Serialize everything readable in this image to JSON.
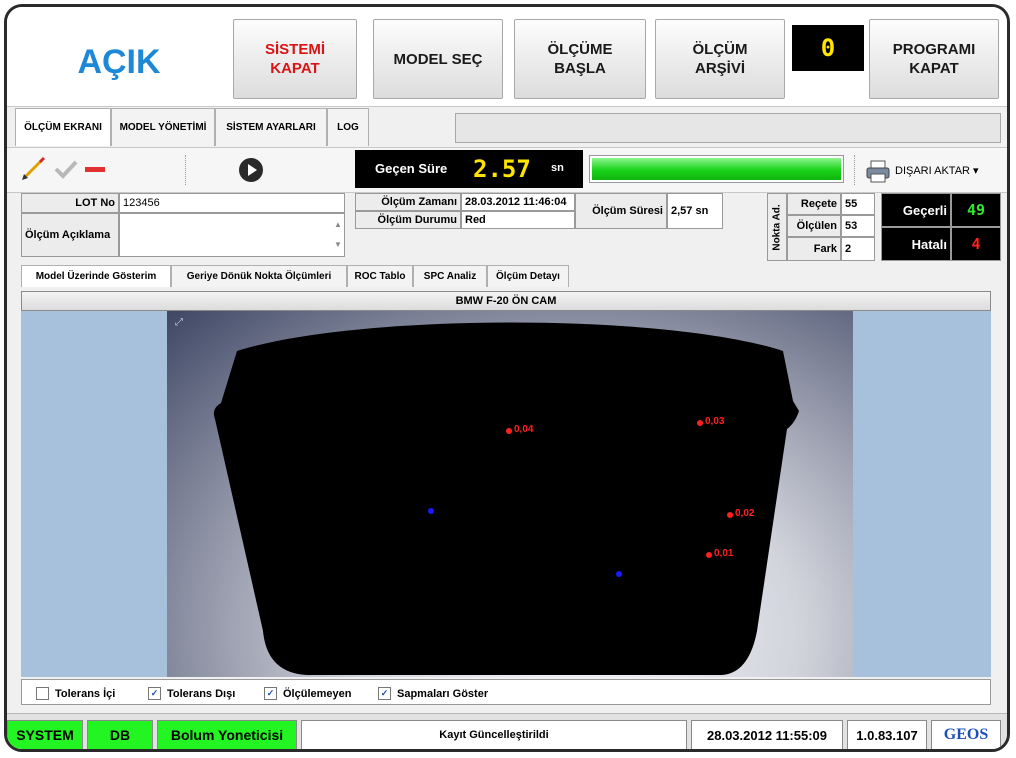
{
  "header": {
    "state": "AÇIK",
    "buttons": {
      "shutdown_system": "SİSTEMİ\nKAPAT",
      "select_model": "MODEL SEÇ",
      "start_measure": "ÖLÇÜME\nBAŞLA",
      "archive": "ÖLÇÜM\nARŞİVİ",
      "close_program": "PROGRAMI\nKAPAT"
    },
    "counter": "0"
  },
  "tabs": [
    "ÖLÇÜM EKRANI",
    "MODEL YÖNETİMİ",
    "SİSTEM AYARLARI",
    "LOG"
  ],
  "toolbar": {
    "elapsed_label": "Geçen Süre",
    "elapsed_value": "2.57",
    "elapsed_unit": "sn",
    "progress": 1.0,
    "export_label": "DIŞARI AKTAR ▾"
  },
  "info": {
    "lot_label": "LOT No",
    "lot_value": "123456",
    "desc_label": "Ölçüm Açıklama",
    "desc_value": "",
    "time_label": "Ölçüm Zamanı",
    "time_value": "28.03.2012 11:46:04",
    "status_label": "Ölçüm Durumu",
    "status_value": "Red",
    "duration_label": "Ölçüm Süresi",
    "duration_value": "2,57 sn"
  },
  "points": {
    "title": "Nokta Ad.",
    "rows": [
      {
        "label": "Reçete",
        "value": "55"
      },
      {
        "label": "Ölçülen",
        "value": "53"
      },
      {
        "label": "Fark",
        "value": "2"
      }
    ]
  },
  "results": {
    "valid_label": "Geçerli",
    "valid_value": "49",
    "invalid_label": "Hatalı",
    "invalid_value": "4"
  },
  "subtabs": [
    "Model Üzerinde Gösterim",
    "Geriye Dönük Nokta Ölçümleri",
    "ROC Tablo",
    "SPC Analiz",
    "Ölçüm Detayı"
  ],
  "view": {
    "title": "BMW F-20 ÖN CAM",
    "points": [
      {
        "label": "0,04",
        "color": "#ff2020"
      },
      {
        "label": "0,03",
        "color": "#ff2020"
      },
      {
        "label": "0,02",
        "color": "#ff2020"
      },
      {
        "label": "0,01",
        "color": "#ff2020"
      },
      {
        "label": "",
        "color": "#1a1aff"
      },
      {
        "label": "",
        "color": "#1a1aff"
      }
    ]
  },
  "checkboxes": [
    {
      "label": "Tolerans İçi",
      "checked": false
    },
    {
      "label": "Tolerans Dışı",
      "checked": true
    },
    {
      "label": "Ölçülemeyen",
      "checked": true
    },
    {
      "label": "Sapmaları Göster",
      "checked": true
    }
  ],
  "statusbar": {
    "system": "SYSTEM",
    "db": "DB",
    "role": "Bolum Yoneticisi",
    "message": "Kayıt Güncelleştirildi",
    "datetime": "28.03.2012 11:55:09",
    "version": "1.0.83.107",
    "brand": "GEOS"
  },
  "colors": {
    "state": "#1e88d8",
    "accent_red": "#d81414",
    "status_green": "#22f522",
    "led_yellow": "#ffe400",
    "led_green": "#2ee82e",
    "led_red": "#ff2020"
  },
  "icons": [
    "pencil-icon",
    "check-icon",
    "minus-icon",
    "play-icon",
    "printer-icon"
  ]
}
